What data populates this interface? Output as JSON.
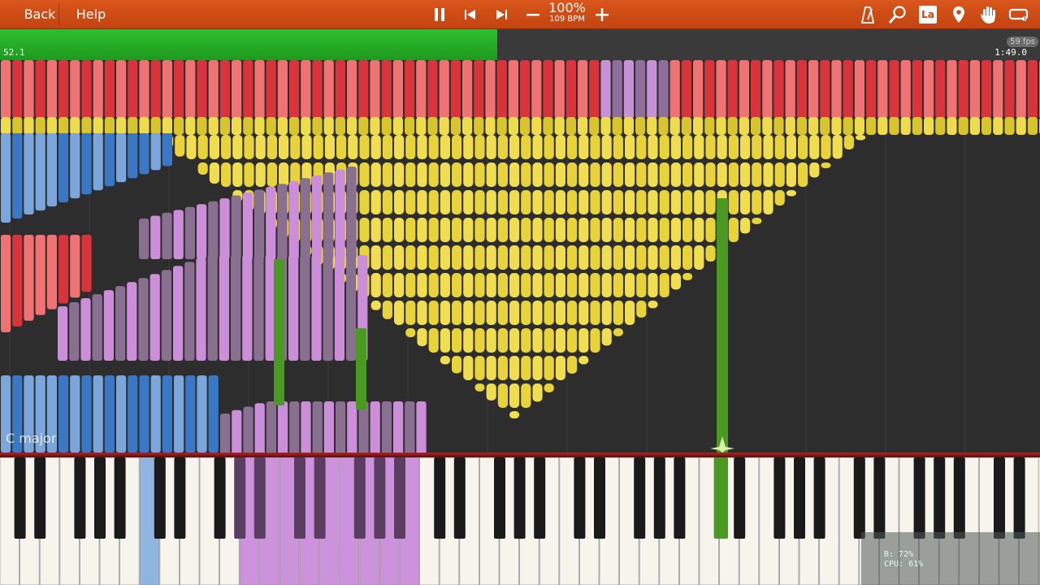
{
  "toolbar": {
    "back_label": "Back",
    "help_label": "Help",
    "tempo_percent": "100%",
    "tempo_bpm": "109 BPM",
    "icons": [
      "pause-icon",
      "skip-back-icon",
      "skip-forward-icon",
      "minus-icon",
      "plus-icon",
      "metronome-icon",
      "search-icon",
      "label-toggle-icon",
      "marker-icon",
      "hand-icon",
      "loop-icon"
    ],
    "label_toggle_text": "La"
  },
  "progress": {
    "elapsed": "52.1",
    "total": "1:49.0",
    "fraction": 0.478,
    "fps": "59 fps"
  },
  "overlay": {
    "key_signature": "C major",
    "cpu": "CPU: 61%",
    "buffer": "B: 72%"
  },
  "colors": {
    "toolbar": "#d4501a",
    "progress": "#27b227",
    "red": "#e8444c",
    "yellow": "#e8d23c",
    "blue": "#3a7ac8",
    "purple": "#c68ad8",
    "green": "#4a9a22"
  }
}
